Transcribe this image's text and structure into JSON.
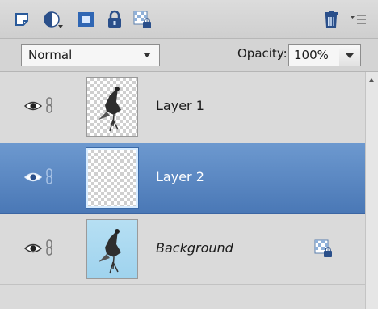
{
  "toolbar": {
    "icons": [
      "new-layer-icon",
      "adjustment-layer-icon",
      "layer-mask-icon",
      "lock-all-icon",
      "lock-transparency-icon",
      "trash-icon",
      "panel-menu-icon"
    ]
  },
  "blend": {
    "mode": "Normal",
    "opacity_label": "Opacity:",
    "opacity_value": "100%"
  },
  "layers": [
    {
      "name": "Layer 1",
      "selected": false,
      "italic": false,
      "thumb": "bird-transparent",
      "locked": false
    },
    {
      "name": "Layer 2",
      "selected": true,
      "italic": false,
      "thumb": "empty-transparent",
      "locked": false
    },
    {
      "name": "Background",
      "selected": false,
      "italic": true,
      "thumb": "bird-sky",
      "locked": true
    }
  ],
  "colors": {
    "selected_row": "#5a87c2",
    "panel_bg": "#d9d9d9",
    "sky": "#a8d8f0"
  }
}
